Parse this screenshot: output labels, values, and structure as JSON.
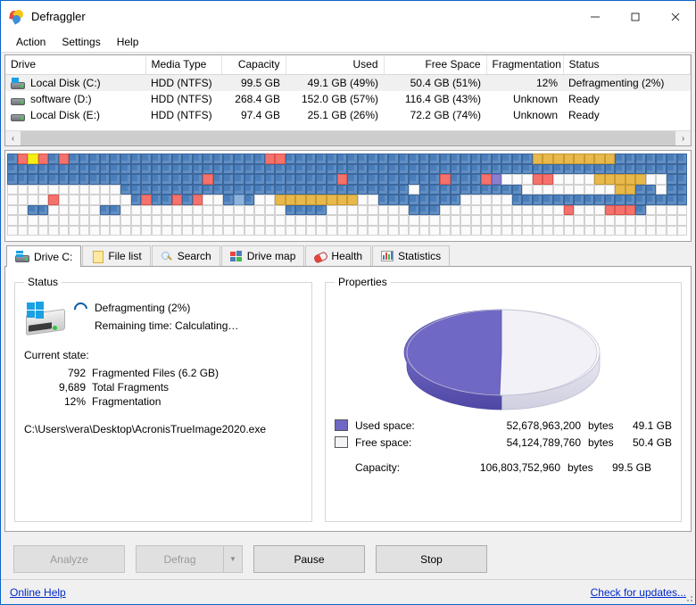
{
  "window": {
    "title": "Defraggler",
    "app_icon": "defraggler-puzzle-icon",
    "minimize_label": "─",
    "maximize_label": "□",
    "close_label": "✕"
  },
  "menu": {
    "items": [
      {
        "label": "Action"
      },
      {
        "label": "Settings"
      },
      {
        "label": "Help"
      }
    ]
  },
  "drive_table": {
    "columns": [
      {
        "label": "Drive",
        "align": "left"
      },
      {
        "label": "Media Type",
        "align": "left"
      },
      {
        "label": "Capacity",
        "align": "right"
      },
      {
        "label": "Used",
        "align": "right"
      },
      {
        "label": "Free Space",
        "align": "right"
      },
      {
        "label": "Fragmentation",
        "align": "right"
      },
      {
        "label": "Status",
        "align": "left"
      }
    ],
    "rows": [
      {
        "drive": "Local Disk (C:)",
        "media_type": "HDD (NTFS)",
        "capacity": "99.5 GB",
        "used": "49.1 GB (49%)",
        "free_space": "50.4 GB (51%)",
        "fragmentation": "12%",
        "status": "Defragmenting (2%)",
        "selected": true,
        "icon": "hard-disk-windows-icon"
      },
      {
        "drive": "software (D:)",
        "media_type": "HDD (NTFS)",
        "capacity": "268.4 GB",
        "used": "152.0 GB (57%)",
        "free_space": "116.4 GB (43%)",
        "fragmentation": "Unknown",
        "status": "Ready",
        "selected": false,
        "icon": "hard-disk-icon"
      },
      {
        "drive": "Local Disk (E:)",
        "media_type": "HDD (NTFS)",
        "capacity": "97.4 GB",
        "used": "25.1 GB (26%)",
        "free_space": "72.2 GB (74%)",
        "fragmentation": "Unknown",
        "status": "Ready",
        "selected": false,
        "icon": "hard-disk-icon"
      }
    ],
    "scroll_left_label": "‹",
    "scroll_right_label": "›"
  },
  "drive_map": {
    "columns": 66,
    "rows": 8,
    "legend_colors": {
      "fragmented": "#f4716c",
      "used": "#4a7ebb",
      "free": "#fbfbfb",
      "being_processed": "#f6ef15",
      "system": "#e8b84b",
      "mft": "#8c7fd0",
      "light_used": "#8fb4dc"
    },
    "blocks": [
      "bryrbrbbbbbbbbbbbbbbbbbbbrrbbbbbbbbbbbbbbbbbbbbbbbboooooooobbbbbbbb",
      "bbbbbbbbbbbbbbbbbbbbbbbbbbbbbbbbbbbbbbbbbbbbbbbbbbbbbbbbbbbbbbbbbb",
      "bbbbbbbbbbbbbbbbbbbrbbbbbbbbbbbbrbbbbbbbbbrbbbrpfffrrffffoooooffbbl",
      "fffffffffffbbbbbbbbbbbbbbbbbbbbbbbbbbbbfbbbbbbbbbbfffffffffoobbfbbb",
      "ffffrfffffffbrbbrbrffblbffooooooooffbbbbbbbbfffffbbbbbbbbbbbbbbbbbb",
      "ffbbfffffbbffffffffffffffffbbbbffffffffbbbffffffffffffrfffrrrbffffff",
      "ffffffffffffffffffffffffffffffffffffffffffffffffffffffffffffffffff",
      "ffffffffffffffffffffffffffffffffffffffffffffffffffffffffffffffffff"
    ]
  },
  "tabs": [
    {
      "label": "Drive C:",
      "icon": "hard-disk-icon",
      "active": true
    },
    {
      "label": "File list",
      "icon": "file-list-icon",
      "active": false
    },
    {
      "label": "Search",
      "icon": "search-icon",
      "active": false
    },
    {
      "label": "Drive map",
      "icon": "drive-map-icon",
      "active": false
    },
    {
      "label": "Health",
      "icon": "health-pill-icon",
      "active": false
    },
    {
      "label": "Statistics",
      "icon": "statistics-bars-icon",
      "active": false
    }
  ],
  "status": {
    "legend": "Status",
    "operation": "Defragmenting (2%)",
    "remaining_time": "Remaining time: Calculating…",
    "current_state_label": "Current state:",
    "stats": [
      {
        "value": "792",
        "label": "Fragmented Files (6.2 GB)"
      },
      {
        "value": "9,689",
        "label": "Total Fragments"
      },
      {
        "value": "12%",
        "label": "Fragmentation"
      }
    ],
    "current_file": "C:\\Users\\vera\\Desktop\\AcronisTrueImage2020.exe"
  },
  "properties": {
    "legend": "Properties",
    "legend_rows": [
      {
        "swatch": "used",
        "label": "Used space:",
        "bytes": "52,678,963,200",
        "unit": "bytes",
        "gb": "49.1 GB"
      },
      {
        "swatch": "free",
        "label": "Free space:",
        "bytes": "54,124,789,760",
        "unit": "bytes",
        "gb": "50.4 GB"
      }
    ],
    "capacity_row": {
      "label": "Capacity:",
      "bytes": "106,803,752,960",
      "unit": "bytes",
      "gb": "99.5 GB"
    }
  },
  "chart_data": {
    "type": "pie",
    "title": "Properties",
    "labels": [
      "Used space",
      "Free space"
    ],
    "values": [
      49.1,
      50.4
    ],
    "percentages": [
      49,
      51
    ],
    "bytes": [
      52678963200,
      54124789760
    ],
    "total_bytes": 106803752960,
    "total_label": "99.5 GB",
    "unit": "GB",
    "colors": [
      "#6f68c4",
      "#f1f1f7"
    ],
    "legend_position": "bottom",
    "style": "3d-ellipse"
  },
  "buttons": {
    "analyze": {
      "label": "Analyze",
      "disabled": true
    },
    "defrag": {
      "label": "Defrag",
      "disabled": true,
      "dropdown_icon": "chevron-down-icon"
    },
    "pause": {
      "label": "Pause",
      "disabled": false
    },
    "stop": {
      "label": "Stop",
      "disabled": false
    }
  },
  "footer": {
    "online_help": "Online Help",
    "check_updates": "Check for updates..."
  }
}
